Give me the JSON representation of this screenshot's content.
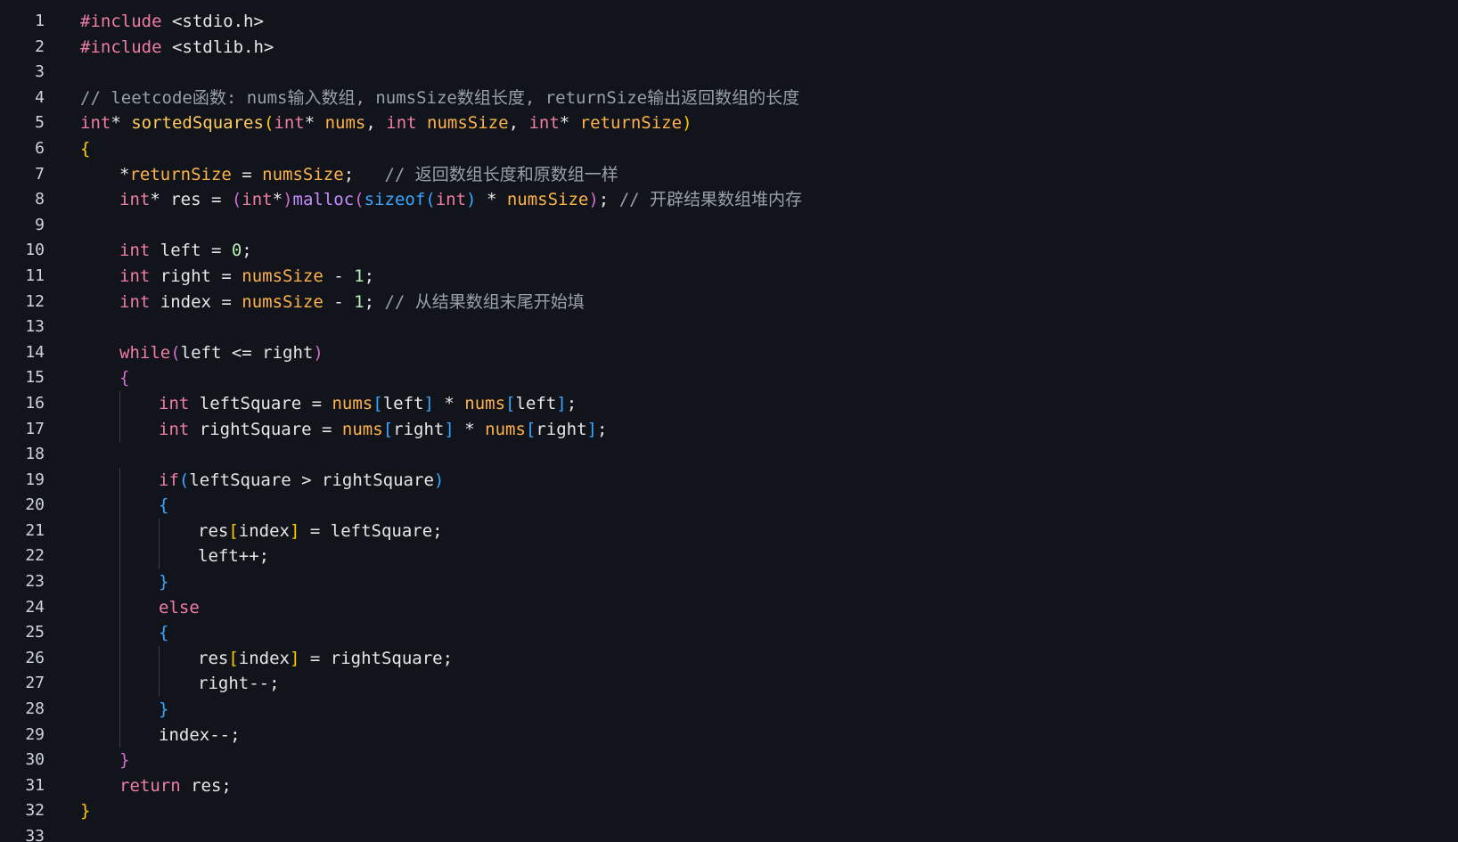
{
  "colors": {
    "background": "#11141a",
    "text": "#e6e6e6",
    "keyword": "#f07ca8",
    "function": "#ffca5f",
    "function_call": "#c58cff",
    "parameter": "#ffb24b",
    "number": "#b5f0b5",
    "comment": "#9aa0aa",
    "brace_level1": "#ffcc00",
    "brace_level2": "#d46cd1",
    "brace_level3": "#3aa6ff"
  },
  "lines": [
    {
      "n": "1",
      "indent": 0,
      "tokens": [
        [
          "preproc",
          "#include"
        ],
        [
          "include",
          " <stdio.h>"
        ]
      ]
    },
    {
      "n": "2",
      "indent": 0,
      "tokens": [
        [
          "preproc",
          "#include"
        ],
        [
          "include",
          " <stdlib.h>"
        ]
      ]
    },
    {
      "n": "3",
      "indent": 0,
      "tokens": []
    },
    {
      "n": "4",
      "indent": 0,
      "tokens": [
        [
          "comment",
          "// leetcode函数: nums输入数组, numsSize数组长度, returnSize输出返回数组的长度"
        ]
      ]
    },
    {
      "n": "5",
      "indent": 0,
      "tokens": [
        [
          "type",
          "int"
        ],
        [
          "text",
          "* "
        ],
        [
          "fn",
          "sortedSquares"
        ],
        [
          "brace1",
          "("
        ],
        [
          "type",
          "int"
        ],
        [
          "text",
          "* "
        ],
        [
          "param",
          "nums"
        ],
        [
          "text",
          ", "
        ],
        [
          "type",
          "int"
        ],
        [
          "text",
          " "
        ],
        [
          "param",
          "numsSize"
        ],
        [
          "text",
          ", "
        ],
        [
          "type",
          "int"
        ],
        [
          "text",
          "* "
        ],
        [
          "param",
          "returnSize"
        ],
        [
          "brace1",
          ")"
        ]
      ]
    },
    {
      "n": "6",
      "indent": 0,
      "tokens": [
        [
          "brace1",
          "{"
        ]
      ]
    },
    {
      "n": "7",
      "indent": 1,
      "tokens": [
        [
          "text",
          "*"
        ],
        [
          "param",
          "returnSize"
        ],
        [
          "text",
          " = "
        ],
        [
          "param",
          "numsSize"
        ],
        [
          "text",
          ";   "
        ],
        [
          "comment",
          "// 返回数组长度和原数组一样"
        ]
      ]
    },
    {
      "n": "8",
      "indent": 1,
      "tokens": [
        [
          "type",
          "int"
        ],
        [
          "text",
          "* res = "
        ],
        [
          "brace2",
          "("
        ],
        [
          "type",
          "int"
        ],
        [
          "text",
          "*"
        ],
        [
          "brace2",
          ")"
        ],
        [
          "fn2",
          "malloc"
        ],
        [
          "brace2",
          "("
        ],
        [
          "sizeof",
          "sizeof"
        ],
        [
          "brace3",
          "("
        ],
        [
          "type",
          "int"
        ],
        [
          "brace3",
          ")"
        ],
        [
          "text",
          " * "
        ],
        [
          "param",
          "numsSize"
        ],
        [
          "brace2",
          ")"
        ],
        [
          "text",
          "; "
        ],
        [
          "comment",
          "// 开辟结果数组堆内存"
        ]
      ]
    },
    {
      "n": "9",
      "indent": 0,
      "tokens": []
    },
    {
      "n": "10",
      "indent": 1,
      "tokens": [
        [
          "type",
          "int"
        ],
        [
          "text",
          " left = "
        ],
        [
          "num",
          "0"
        ],
        [
          "text",
          ";"
        ]
      ]
    },
    {
      "n": "11",
      "indent": 1,
      "tokens": [
        [
          "type",
          "int"
        ],
        [
          "text",
          " right = "
        ],
        [
          "param",
          "numsSize"
        ],
        [
          "text",
          " - "
        ],
        [
          "num",
          "1"
        ],
        [
          "text",
          ";"
        ]
      ]
    },
    {
      "n": "12",
      "indent": 1,
      "tokens": [
        [
          "type",
          "int"
        ],
        [
          "text",
          " index = "
        ],
        [
          "param",
          "numsSize"
        ],
        [
          "text",
          " - "
        ],
        [
          "num",
          "1"
        ],
        [
          "text",
          "; "
        ],
        [
          "comment",
          "// 从结果数组末尾开始填"
        ]
      ]
    },
    {
      "n": "13",
      "indent": 0,
      "tokens": []
    },
    {
      "n": "14",
      "indent": 1,
      "tokens": [
        [
          "kw",
          "while"
        ],
        [
          "brace2",
          "("
        ],
        [
          "text",
          "left <= right"
        ],
        [
          "brace2",
          ")"
        ]
      ]
    },
    {
      "n": "15",
      "indent": 1,
      "tokens": [
        [
          "brace2",
          "{"
        ]
      ]
    },
    {
      "n": "16",
      "indent": 2,
      "tokens": [
        [
          "type",
          "int"
        ],
        [
          "text",
          " leftSquare = "
        ],
        [
          "param",
          "nums"
        ],
        [
          "brace3",
          "["
        ],
        [
          "text",
          "left"
        ],
        [
          "brace3",
          "]"
        ],
        [
          "text",
          " * "
        ],
        [
          "param",
          "nums"
        ],
        [
          "brace3",
          "["
        ],
        [
          "text",
          "left"
        ],
        [
          "brace3",
          "]"
        ],
        [
          "text",
          ";"
        ]
      ]
    },
    {
      "n": "17",
      "indent": 2,
      "tokens": [
        [
          "type",
          "int"
        ],
        [
          "text",
          " rightSquare = "
        ],
        [
          "param",
          "nums"
        ],
        [
          "brace3",
          "["
        ],
        [
          "text",
          "right"
        ],
        [
          "brace3",
          "]"
        ],
        [
          "text",
          " * "
        ],
        [
          "param",
          "nums"
        ],
        [
          "brace3",
          "["
        ],
        [
          "text",
          "right"
        ],
        [
          "brace3",
          "]"
        ],
        [
          "text",
          ";"
        ]
      ]
    },
    {
      "n": "18",
      "indent": 0,
      "tokens": []
    },
    {
      "n": "19",
      "indent": 2,
      "tokens": [
        [
          "kw",
          "if"
        ],
        [
          "brace3",
          "("
        ],
        [
          "text",
          "leftSquare > rightSquare"
        ],
        [
          "brace3",
          ")"
        ]
      ]
    },
    {
      "n": "20",
      "indent": 2,
      "tokens": [
        [
          "brace3",
          "{"
        ]
      ]
    },
    {
      "n": "21",
      "indent": 3,
      "tokens": [
        [
          "text",
          "res"
        ],
        [
          "brace1",
          "["
        ],
        [
          "text",
          "index"
        ],
        [
          "brace1",
          "]"
        ],
        [
          "text",
          " = leftSquare;"
        ]
      ]
    },
    {
      "n": "22",
      "indent": 3,
      "tokens": [
        [
          "text",
          "left++;"
        ]
      ]
    },
    {
      "n": "23",
      "indent": 2,
      "tokens": [
        [
          "brace3",
          "}"
        ]
      ]
    },
    {
      "n": "24",
      "indent": 2,
      "tokens": [
        [
          "kw",
          "else"
        ]
      ]
    },
    {
      "n": "25",
      "indent": 2,
      "tokens": [
        [
          "brace3",
          "{"
        ]
      ]
    },
    {
      "n": "26",
      "indent": 3,
      "tokens": [
        [
          "text",
          "res"
        ],
        [
          "brace1",
          "["
        ],
        [
          "text",
          "index"
        ],
        [
          "brace1",
          "]"
        ],
        [
          "text",
          " = rightSquare;"
        ]
      ]
    },
    {
      "n": "27",
      "indent": 3,
      "tokens": [
        [
          "text",
          "right--;"
        ]
      ]
    },
    {
      "n": "28",
      "indent": 2,
      "tokens": [
        [
          "brace3",
          "}"
        ]
      ]
    },
    {
      "n": "29",
      "indent": 2,
      "tokens": [
        [
          "text",
          "index--;"
        ]
      ]
    },
    {
      "n": "30",
      "indent": 1,
      "tokens": [
        [
          "brace2",
          "}"
        ]
      ]
    },
    {
      "n": "31",
      "indent": 1,
      "tokens": [
        [
          "kw",
          "return"
        ],
        [
          "text",
          " res;"
        ]
      ]
    },
    {
      "n": "32",
      "indent": 0,
      "tokens": [
        [
          "brace1",
          "}"
        ]
      ]
    },
    {
      "n": "33",
      "indent": 0,
      "tokens": []
    }
  ]
}
